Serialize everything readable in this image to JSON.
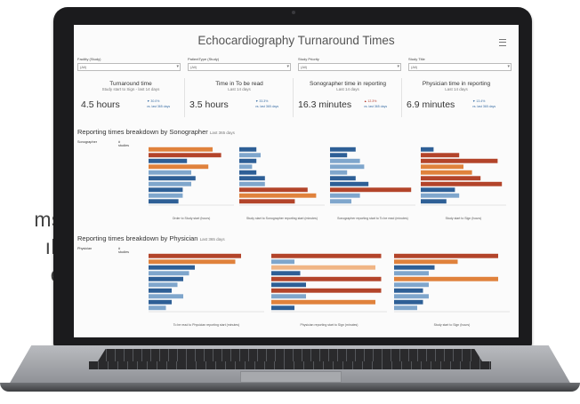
{
  "side_text": [
    "ms",
    "ıl,",
    "e"
  ],
  "dashboard": {
    "title": "Echocardiography Turnaround Times",
    "filters": [
      {
        "label": "Facility (Study)",
        "value": "(All)"
      },
      {
        "label": "PatientType (Study)",
        "value": "(All)"
      },
      {
        "label": "Study Priority",
        "value": "(All)"
      },
      {
        "label": "Study Title",
        "value": "(All)"
      }
    ],
    "kpis": [
      {
        "title": "Turnaround time",
        "sub": "Study start to Sign - last 14 days",
        "value": "4.5 hours",
        "delta": "▼ 30.0%",
        "delta2": "vs. last 365 days",
        "trend": "down"
      },
      {
        "title": "Time in To be read",
        "sub": "Last 14 days",
        "value": "3.5 hours",
        "delta": "▼ 33.3%",
        "delta2": "vs. last 365 days",
        "trend": "down"
      },
      {
        "title": "Sonographer time in reporting",
        "sub": "Last 14 days",
        "value": "16.3 minutes",
        "delta": "▲ 12.3%",
        "delta2": "vs. last 365 days",
        "trend": "up"
      },
      {
        "title": "Physician time in reporting",
        "sub": "Last 14 days",
        "value": "6.9 minutes",
        "delta": "▼ 13.4%",
        "delta2": "vs. last 365 days",
        "trend": "down"
      }
    ],
    "sonographer_section": {
      "title": "Reporting times breakdown by Sonographer",
      "sub": "Last 365 days",
      "col1": "Sonographer",
      "col2": "# studies",
      "axis_titles": [
        "Order to Study start (hours)",
        "Study start to Sonographer reporting start (minutes)",
        "Sonographer reporting start to To be read (minutes)",
        "Study start to Sign (hours)"
      ]
    },
    "physician_section": {
      "title": "Reporting times breakdown by Physician",
      "sub": "Last 365 days",
      "col1": "Physician",
      "col2": "# studies",
      "axis_titles": [
        "To be read to Physician reporting start (minutes)",
        "Physician reporting start to Sign (minutes)",
        "Study start to Sign (hours)"
      ]
    }
  },
  "colors": {
    "dark_blue": "#2e5f96",
    "light_blue": "#7fa6cc",
    "dark_orange": "#b3442a",
    "orange": "#e0823c",
    "light_orange": "#f0b585"
  }
}
